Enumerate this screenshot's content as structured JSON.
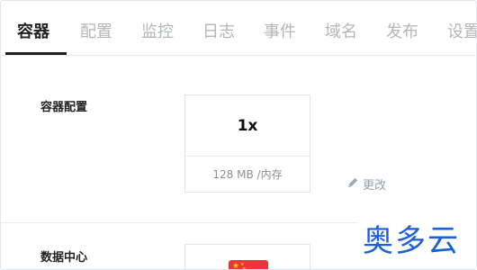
{
  "tabs": [
    {
      "label": "容器",
      "active": true
    },
    {
      "label": "配置"
    },
    {
      "label": "监控"
    },
    {
      "label": "日志"
    },
    {
      "label": "事件"
    },
    {
      "label": "域名"
    },
    {
      "label": "发布"
    },
    {
      "label": "设置"
    }
  ],
  "container_config": {
    "label": "容器配置",
    "instances": "1x",
    "memory": "128 MB /内存",
    "edit_label": "更改"
  },
  "data_center": {
    "label": "数据中心",
    "flag": "china-flag-icon"
  },
  "watermark": "奥多云",
  "colors": {
    "active_tab": "#222222",
    "inactive_tab": "#b3b6b9",
    "watermark": "#1b5fd9",
    "flag": "#e8373c"
  }
}
